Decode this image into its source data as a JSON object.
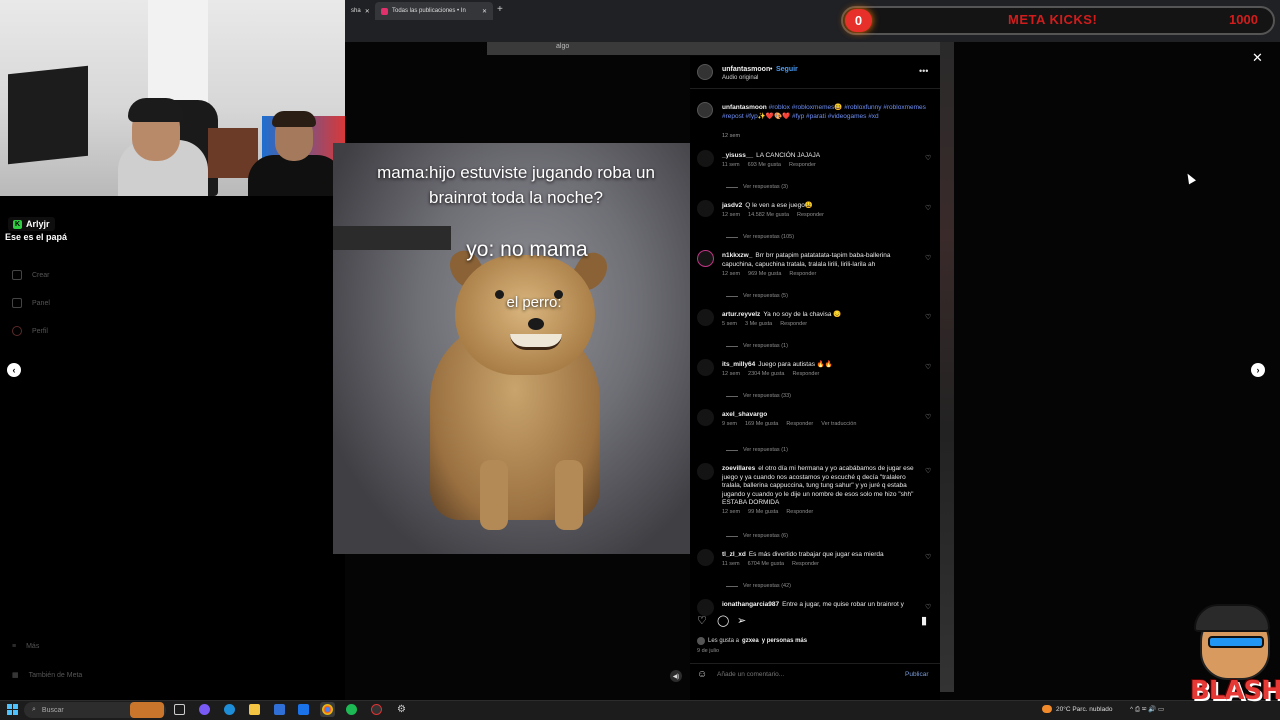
{
  "browser": {
    "active_tab_title": "Todas las publicaciones • In",
    "prev_tab_title": "sha",
    "new_tab": "+"
  },
  "meta_overlay": {
    "count": "0",
    "title": "META KICKS!",
    "goal": "1000"
  },
  "page": {
    "strip_label": "algo",
    "sidebar": [
      "Crear",
      "Panel",
      "Perfil",
      "Más",
      "También de Meta"
    ]
  },
  "chat": {
    "username": "Arlyjr",
    "message": "Ese es el papá"
  },
  "video": {
    "caption_line1": "mama:hijo estuviste jugando roba un brainrot toda la noche?",
    "caption_line2": "yo: no mama",
    "caption_line3": "el perro:"
  },
  "post": {
    "author": "unfantasmoon",
    "separator": "•",
    "follow": "Seguir",
    "audio": "Audio original",
    "more_icon": "more-icon",
    "caption_user": "unfantasmoon",
    "caption_tags": "#roblox #robloxmemes😃 #robloxfunny #robloxmemes #repost #fyp✨❤️🎨❤️ #fyp #parati #videogames #xd",
    "caption_time": "12 sem",
    "likes_prefix": "Les gusta a",
    "likes_user": "gzxea",
    "likes_suffix": "y personas más",
    "date": "9 de julio",
    "comment_placeholder": "Añade un comentario...",
    "publish": "Publicar",
    "close": "✕",
    "prev": "‹",
    "next": "›"
  },
  "comments": [
    {
      "user": "_yisuss__",
      "text": "LA CANCIÓN JAJAJA",
      "time": "11 sem",
      "likes": "693 Me gusta",
      "reply": "Responder",
      "extra": "",
      "replies": "Ver respuestas (3)"
    },
    {
      "user": "jasdv2",
      "text": "Q le ven a ese juego😩",
      "time": "12 sem",
      "likes": "14.582 Me gusta",
      "reply": "Responder",
      "extra": "",
      "replies": "Ver respuestas (105)"
    },
    {
      "user": "n1kkxzw_",
      "text": "Brr brr patapim patatatata-tapim baba-ballerina capuchina, capuchina tratala, tralala lirili, lirili-larila ah",
      "time": "12 sem",
      "likes": "969 Me gusta",
      "reply": "Responder",
      "extra": "",
      "replies": "Ver respuestas (5)"
    },
    {
      "user": "artur.reyvelz",
      "text": "Ya no soy de la chavisa 😔",
      "time": "5 sem",
      "likes": "3 Me gusta",
      "reply": "Responder",
      "extra": "",
      "replies": "Ver respuestas (1)"
    },
    {
      "user": "its_milly64",
      "text": "Juego para autistas 🔥🔥",
      "time": "12 sem",
      "likes": "2304 Me gusta",
      "reply": "Responder",
      "extra": "",
      "replies": "Ver respuestas (33)"
    },
    {
      "user": "axel_shavargo",
      "text": "",
      "time": "9 sem",
      "likes": "169 Me gusta",
      "reply": "Responder",
      "extra": "Ver traducción",
      "replies": "Ver respuestas (1)"
    },
    {
      "user": "zoevillares",
      "text": "el otro día mi hermana y yo acabábamos de jugar ese juego y ya cuando nos acostamos yo escuché q decía \"tralalero tralala, ballerina cappuccina, tung tung sahur\" y yo juré q estaba jugando y cuando yo le dije un nombre de esos solo me hizo \"shh\" ESTABA DORMIDA",
      "time": "12 sem",
      "likes": "99 Me gusta",
      "reply": "Responder",
      "extra": "",
      "replies": "Ver respuestas (6)"
    },
    {
      "user": "tl_zl_xd",
      "text": "Es más divertido trabajar que jugar esa mierda",
      "time": "11 sem",
      "likes": "6704 Me gusta",
      "reply": "Responder",
      "extra": "",
      "replies": "Ver respuestas (42)"
    },
    {
      "user": "ionathangarcia987",
      "text": "Entre a jugar, me quise robar un brainrot y",
      "time": "",
      "likes": "",
      "reply": "",
      "extra": "",
      "replies": ""
    }
  ],
  "taskbar": {
    "search_placeholder": "Buscar",
    "weather": "20°C  Parc. nublado",
    "tray": "^  ⎙  ✉  🔊  ▭"
  },
  "branding": {
    "logo_text": "BLASH"
  },
  "colors": {
    "follow_blue": "#4a9df8",
    "hashtag_blue": "#6d8ff5",
    "meta_red": "#d21c1c",
    "logo_red": "#e53935"
  }
}
